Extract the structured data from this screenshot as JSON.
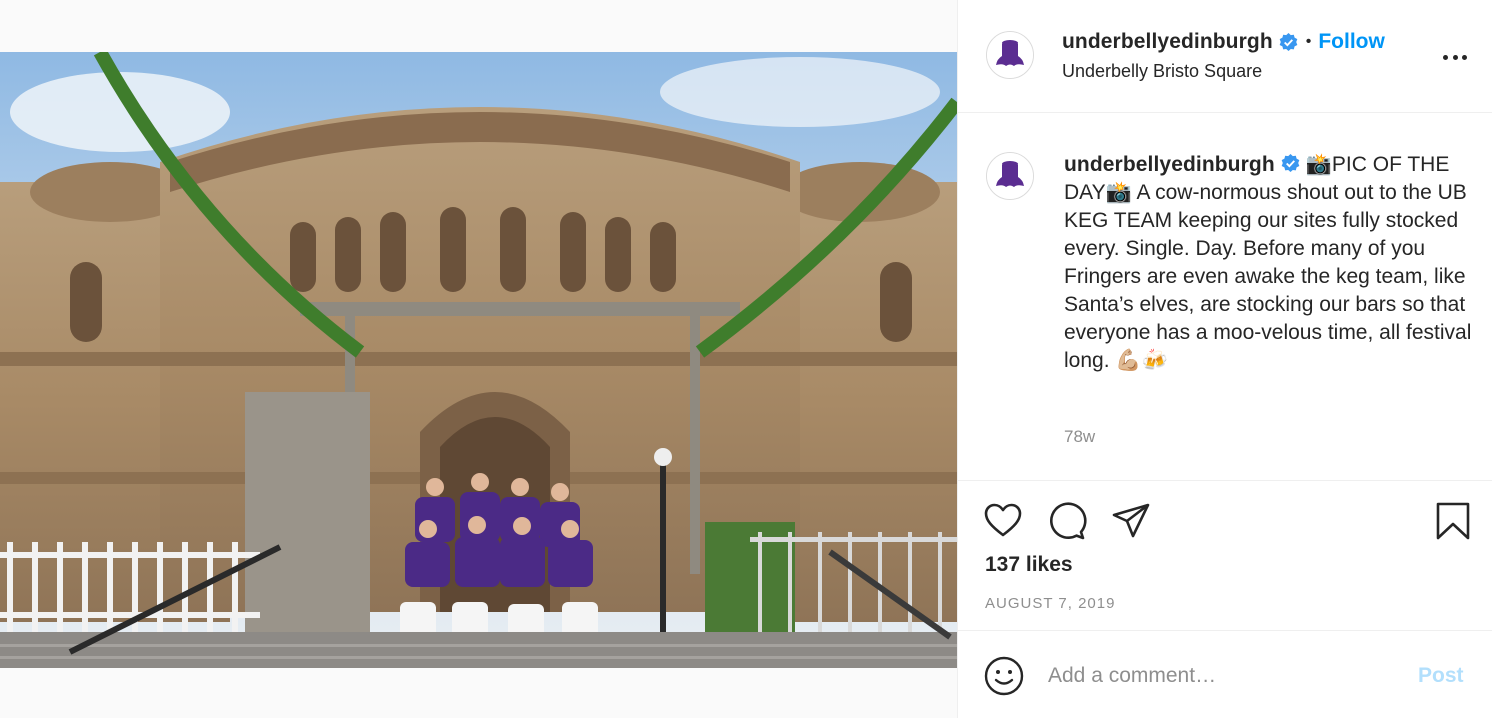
{
  "post": {
    "username": "underbellyedinburgh",
    "follow_label": "Follow",
    "dot": "•",
    "location": "Underbelly Bristo Square",
    "caption_user": "underbellyedinburgh",
    "caption_text": "📸PIC OF THE DAY📸 A cow-normous shout out to the UB KEG TEAM keeping our sites fully stocked every. Single. Day. Before many of you Fringers are even awake the keg team, like Santa’s elves, are stocking our bars so that everyone has a moo-velous time, all festival long. 💪🏼🍻",
    "time_ago": "78w",
    "likes": "137 likes",
    "date": "AUGUST 7, 2019"
  },
  "comment": {
    "placeholder": "Add a comment…",
    "post_label": "Post"
  },
  "icons": {
    "more": "more-options-icon",
    "like": "heart-icon",
    "comment": "comment-bubble-icon",
    "share": "paper-plane-icon",
    "save": "bookmark-icon",
    "emoji": "smiley-icon",
    "verified": "verified-badge-icon"
  },
  "colors": {
    "link_blue": "#0095f6",
    "post_disabled": "#b2dffc",
    "brand_purple": "#5b2d91",
    "muted": "#8e8e8e"
  }
}
